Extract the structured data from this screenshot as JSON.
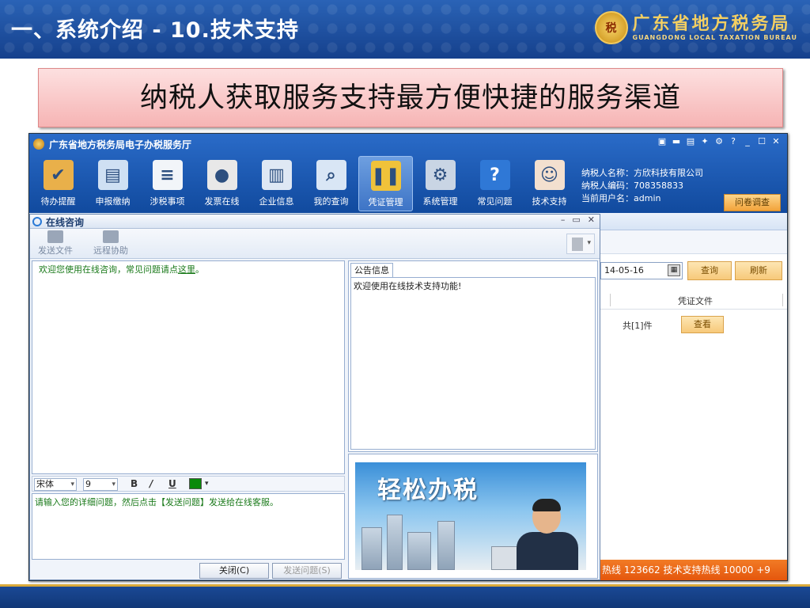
{
  "slide": {
    "title": "一、系统介绍 - 10.技术支持",
    "bureau_cn": "广东省地方税务局",
    "bureau_en": "GUANGDONG LOCAL TAXATION BUREAU",
    "emblem_text": "税",
    "banner": "纳税人获取服务支持最方便快捷的服务渠道"
  },
  "app": {
    "title": "广东省地方税务局电子办税服务厅",
    "window_controls": [
      "▣",
      "▬",
      "▤",
      "✦",
      "⚙",
      "?",
      "_",
      "☐",
      "✕"
    ],
    "toolbar": [
      {
        "label": "待办提醒",
        "icon": "clipboard-icon",
        "glyph": "✔",
        "color": "#e9b04a"
      },
      {
        "label": "申报缴纳",
        "icon": "monitor-icon",
        "glyph": "▤",
        "color": "#cfe0f3"
      },
      {
        "label": "涉税事项",
        "icon": "document-icon",
        "glyph": "≡",
        "color": "#f2f5f9"
      },
      {
        "label": "发票在线",
        "icon": "stamp-icon",
        "glyph": "●",
        "color": "#e8e8e8"
      },
      {
        "label": "企业信息",
        "icon": "building-icon",
        "glyph": "▥",
        "color": "#dfe8f4"
      },
      {
        "label": "我的查询",
        "icon": "magnifier-icon",
        "glyph": "⌕",
        "color": "#d9e6f5"
      },
      {
        "label": "凭证管理",
        "icon": "binders-icon",
        "glyph": "❚❚",
        "color": "#f0c23a"
      },
      {
        "label": "系统管理",
        "icon": "gear-icon",
        "glyph": "⚙",
        "color": "#c9d5e4"
      },
      {
        "label": "常见问题",
        "icon": "help-icon",
        "glyph": "?",
        "color": "#2f78d6"
      },
      {
        "label": "技术支持",
        "icon": "support-agent-icon",
        "glyph": "☺",
        "color": "#f3e0cf"
      }
    ],
    "active_tool": 6,
    "user": {
      "name_line": "纳税人名称：方欣科技有限公司",
      "code_line": "纳税人编码：708358833",
      "current_line": "当前用户名：admin"
    },
    "survey_button": "问卷调查"
  },
  "background_panel": {
    "date_value": "14-05-16",
    "query_button": "查询",
    "refresh_button": "刷新",
    "column_header": "凭证文件",
    "total_text": "共[1]件",
    "view_button": "查看",
    "hotline": "热线 123662  技术支持热线 10000 +9"
  },
  "chat": {
    "title": "在线咨询",
    "controls": [
      "–",
      "▭",
      "✕"
    ],
    "send_file": "发送文件",
    "remote_assist": "远程协助",
    "welcome_prefix": "欢迎您使用在线咨询，常见问题请点",
    "welcome_link": "这里",
    "welcome_suffix": "。",
    "notice_tab": "公告信息",
    "notice_text": "欢迎使用在线技术支持功能!",
    "ad_slogan": "轻松办税",
    "font_name": "宋体",
    "font_size": "9",
    "bold": "B",
    "italic": "/",
    "underline": "U",
    "input_hint": "请输入您的详细问题，然后点击【发送问题】发送给在线客服。",
    "close_button": "关闭(C)",
    "send_button": "发送问题(S)"
  },
  "colors": {
    "header_blue": "#1f55a8",
    "accent_orange": "#f27b25",
    "text_green": "#1a7a1a"
  }
}
